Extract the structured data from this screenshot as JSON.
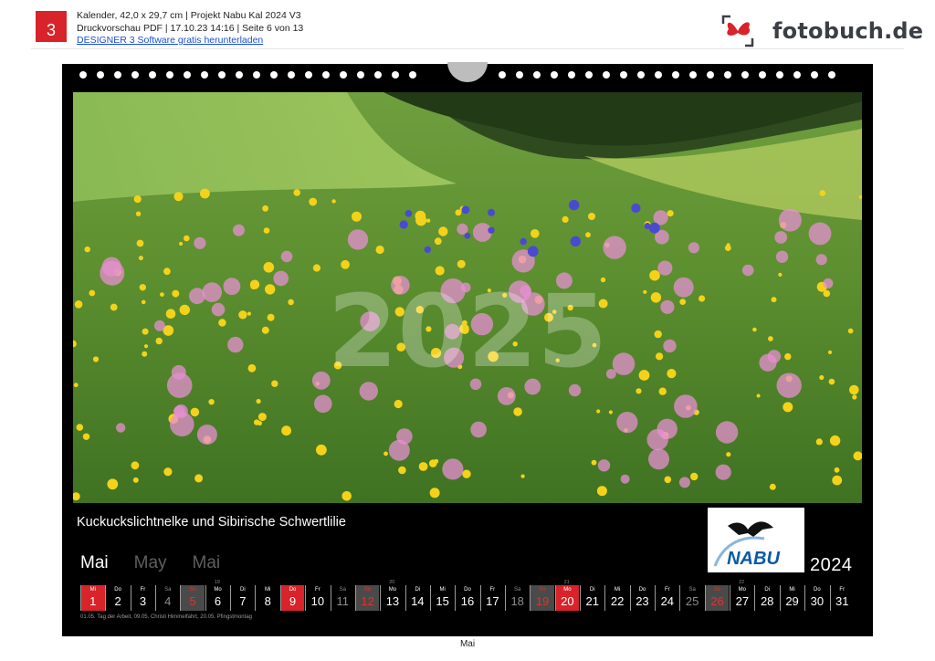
{
  "header": {
    "page_number": "3",
    "line1": "Kalender, 42,0 x 29,7 cm | Projekt Nabu Kal 2024 V3",
    "line2": "Druckvorschau PDF | 17.10.23 14:16 | Seite 6 von 13",
    "link": "DESIGNER 3 Software gratis herunterladen",
    "logo_text": "fotobuch.de"
  },
  "calendar": {
    "caption": "Kuckuckslichtnelke und Sibirische Schwertlilie",
    "watermark": "2025",
    "month_names": [
      "Mai",
      "May",
      "Mai"
    ],
    "year": "2024",
    "week_numbers": [
      "19",
      "20",
      "21",
      "22"
    ],
    "days": [
      {
        "dn": "Mi",
        "d": "1",
        "t": "hol"
      },
      {
        "dn": "Do",
        "d": "2",
        "t": ""
      },
      {
        "dn": "Fr",
        "d": "3",
        "t": ""
      },
      {
        "dn": "Sa",
        "d": "4",
        "t": "sat"
      },
      {
        "dn": "So",
        "d": "5",
        "t": "sun"
      },
      {
        "dn": "Mo",
        "d": "6",
        "t": ""
      },
      {
        "dn": "Di",
        "d": "7",
        "t": ""
      },
      {
        "dn": "Mi",
        "d": "8",
        "t": ""
      },
      {
        "dn": "Do",
        "d": "9",
        "t": "hol"
      },
      {
        "dn": "Fr",
        "d": "10",
        "t": ""
      },
      {
        "dn": "Sa",
        "d": "11",
        "t": "sat"
      },
      {
        "dn": "So",
        "d": "12",
        "t": "sun"
      },
      {
        "dn": "Mo",
        "d": "13",
        "t": ""
      },
      {
        "dn": "Di",
        "d": "14",
        "t": ""
      },
      {
        "dn": "Mi",
        "d": "15",
        "t": ""
      },
      {
        "dn": "Do",
        "d": "16",
        "t": ""
      },
      {
        "dn": "Fr",
        "d": "17",
        "t": ""
      },
      {
        "dn": "Sa",
        "d": "18",
        "t": "sat"
      },
      {
        "dn": "So",
        "d": "19",
        "t": "sun"
      },
      {
        "dn": "Mo",
        "d": "20",
        "t": "hol"
      },
      {
        "dn": "Di",
        "d": "21",
        "t": ""
      },
      {
        "dn": "Mi",
        "d": "22",
        "t": ""
      },
      {
        "dn": "Do",
        "d": "23",
        "t": ""
      },
      {
        "dn": "Fr",
        "d": "24",
        "t": ""
      },
      {
        "dn": "Sa",
        "d": "25",
        "t": "sat"
      },
      {
        "dn": "So",
        "d": "26",
        "t": "sun"
      },
      {
        "dn": "Mo",
        "d": "27",
        "t": ""
      },
      {
        "dn": "Di",
        "d": "28",
        "t": ""
      },
      {
        "dn": "Mi",
        "d": "29",
        "t": ""
      },
      {
        "dn": "Do",
        "d": "30",
        "t": ""
      },
      {
        "dn": "Fr",
        "d": "31",
        "t": ""
      }
    ],
    "holidays_note": "01.05. Tag der Arbeit, 09.05. Christi Himmelfahrt, 20.05. Pfingstmontag",
    "nabu_logo_text": "NABU"
  },
  "footer": {
    "label": "Mai"
  },
  "colors": {
    "accent_red": "#d8232a",
    "sheet_black": "#000000",
    "link_blue": "#1a4fd6"
  }
}
